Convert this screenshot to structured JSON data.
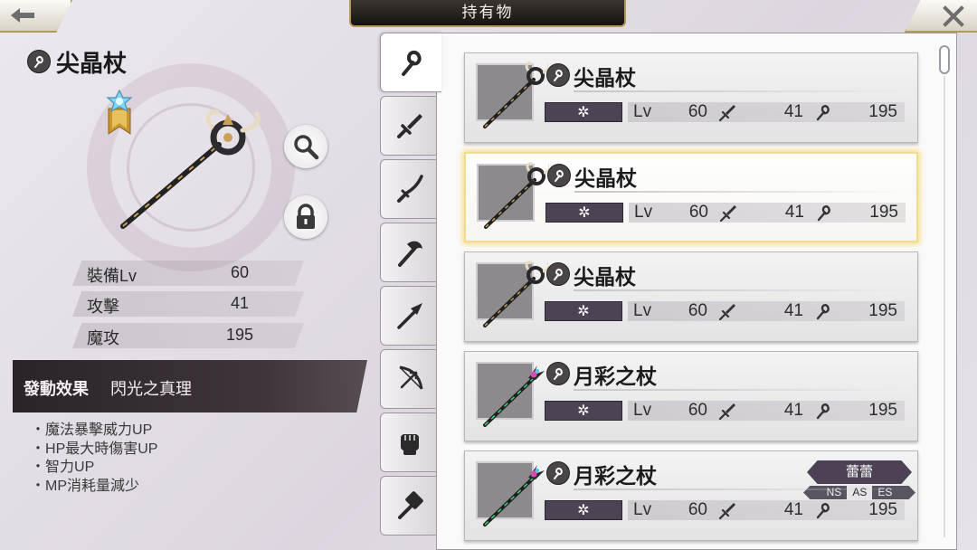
{
  "header": {
    "title": "持有物"
  },
  "detail": {
    "item_name": "尖晶杖",
    "stats": [
      {
        "label": "裝備Lv",
        "value": "60"
      },
      {
        "label": "攻擊",
        "value": "41"
      },
      {
        "label": "魔攻",
        "value": "195"
      }
    ],
    "effect_label": "發動效果",
    "effect_name": "閃光之真理",
    "effects": [
      "魔法暴擊威力UP",
      "HP最大時傷害UP",
      "智力UP",
      "MP消耗量減少"
    ]
  },
  "tabs": [
    "staff-icon",
    "sword-icon",
    "katana-icon",
    "axe-icon",
    "spear-icon",
    "bow-icon",
    "fist-icon",
    "hammer-icon"
  ],
  "list": {
    "items": [
      {
        "name": "尖晶杖",
        "element": "✲",
        "lv_label": "Lv",
        "lv": "60",
        "atk": "41",
        "matk": "195"
      },
      {
        "name": "尖晶杖",
        "element": "✲",
        "lv_label": "Lv",
        "lv": "60",
        "atk": "41",
        "matk": "195"
      },
      {
        "name": "尖晶杖",
        "element": "✲",
        "lv_label": "Lv",
        "lv": "60",
        "atk": "41",
        "matk": "195"
      },
      {
        "name": "月彩之杖",
        "element": "✲",
        "lv_label": "Lv",
        "lv": "60",
        "atk": "41",
        "matk": "195"
      },
      {
        "name": "月彩之杖",
        "element": "✲",
        "lv_label": "Lv",
        "lv": "60",
        "atk": "41",
        "matk": "195",
        "owner": "蕾蕾",
        "modes": [
          "NS",
          "AS",
          "ES"
        ]
      }
    ]
  },
  "colors": {
    "accent_gold": "#b4985a",
    "element_bg": "#4c4354",
    "selected_glow": "#f3dc8c"
  }
}
